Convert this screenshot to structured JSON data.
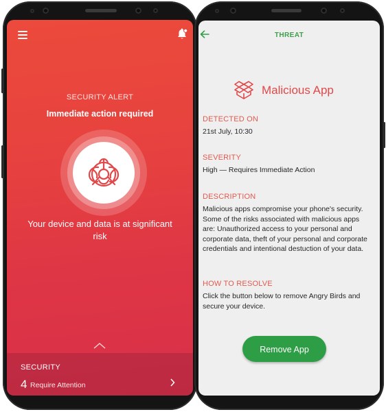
{
  "alert_screen": {
    "label": "SECURITY ALERT",
    "headline": "Immediate action required",
    "message": "Your device and data is at significant risk",
    "security_panel": {
      "title": "SECURITY",
      "count": "4",
      "count_label": "Require Attention"
    },
    "icons": [
      "menu-icon",
      "bell-icon",
      "biohazard-icon",
      "chevron-up-icon",
      "chevron-right-icon"
    ]
  },
  "threat_screen": {
    "title": "THREAT",
    "app_name": "Malicious App",
    "detected_on": {
      "heading": "DETECTED ON",
      "value": "21st July, 10:30"
    },
    "severity": {
      "heading": "SEVERITY",
      "value": "High — Requires Immediate Action"
    },
    "description": {
      "heading": "DESCRIPTION",
      "value": "Malicious apps compromise your phone's security. Some of the risks associated with malicious apps are: Unauthorized access to your personal and corporate data, theft of your personal and corporate credentials and intentional destuction of your data."
    },
    "how_to_resolve": {
      "heading": "HOW TO RESOLVE",
      "value": "Click the button below to remove Angry Birds and secure your device."
    },
    "remove_button": "Remove App",
    "icons": [
      "back-arrow-icon",
      "dropbox-box-icon"
    ]
  },
  "colors": {
    "alert_red": "#e7423f",
    "threat_green": "#2e9e46",
    "threat_heading_red": "#e25a4e",
    "app_name_red": "#e0484a"
  }
}
